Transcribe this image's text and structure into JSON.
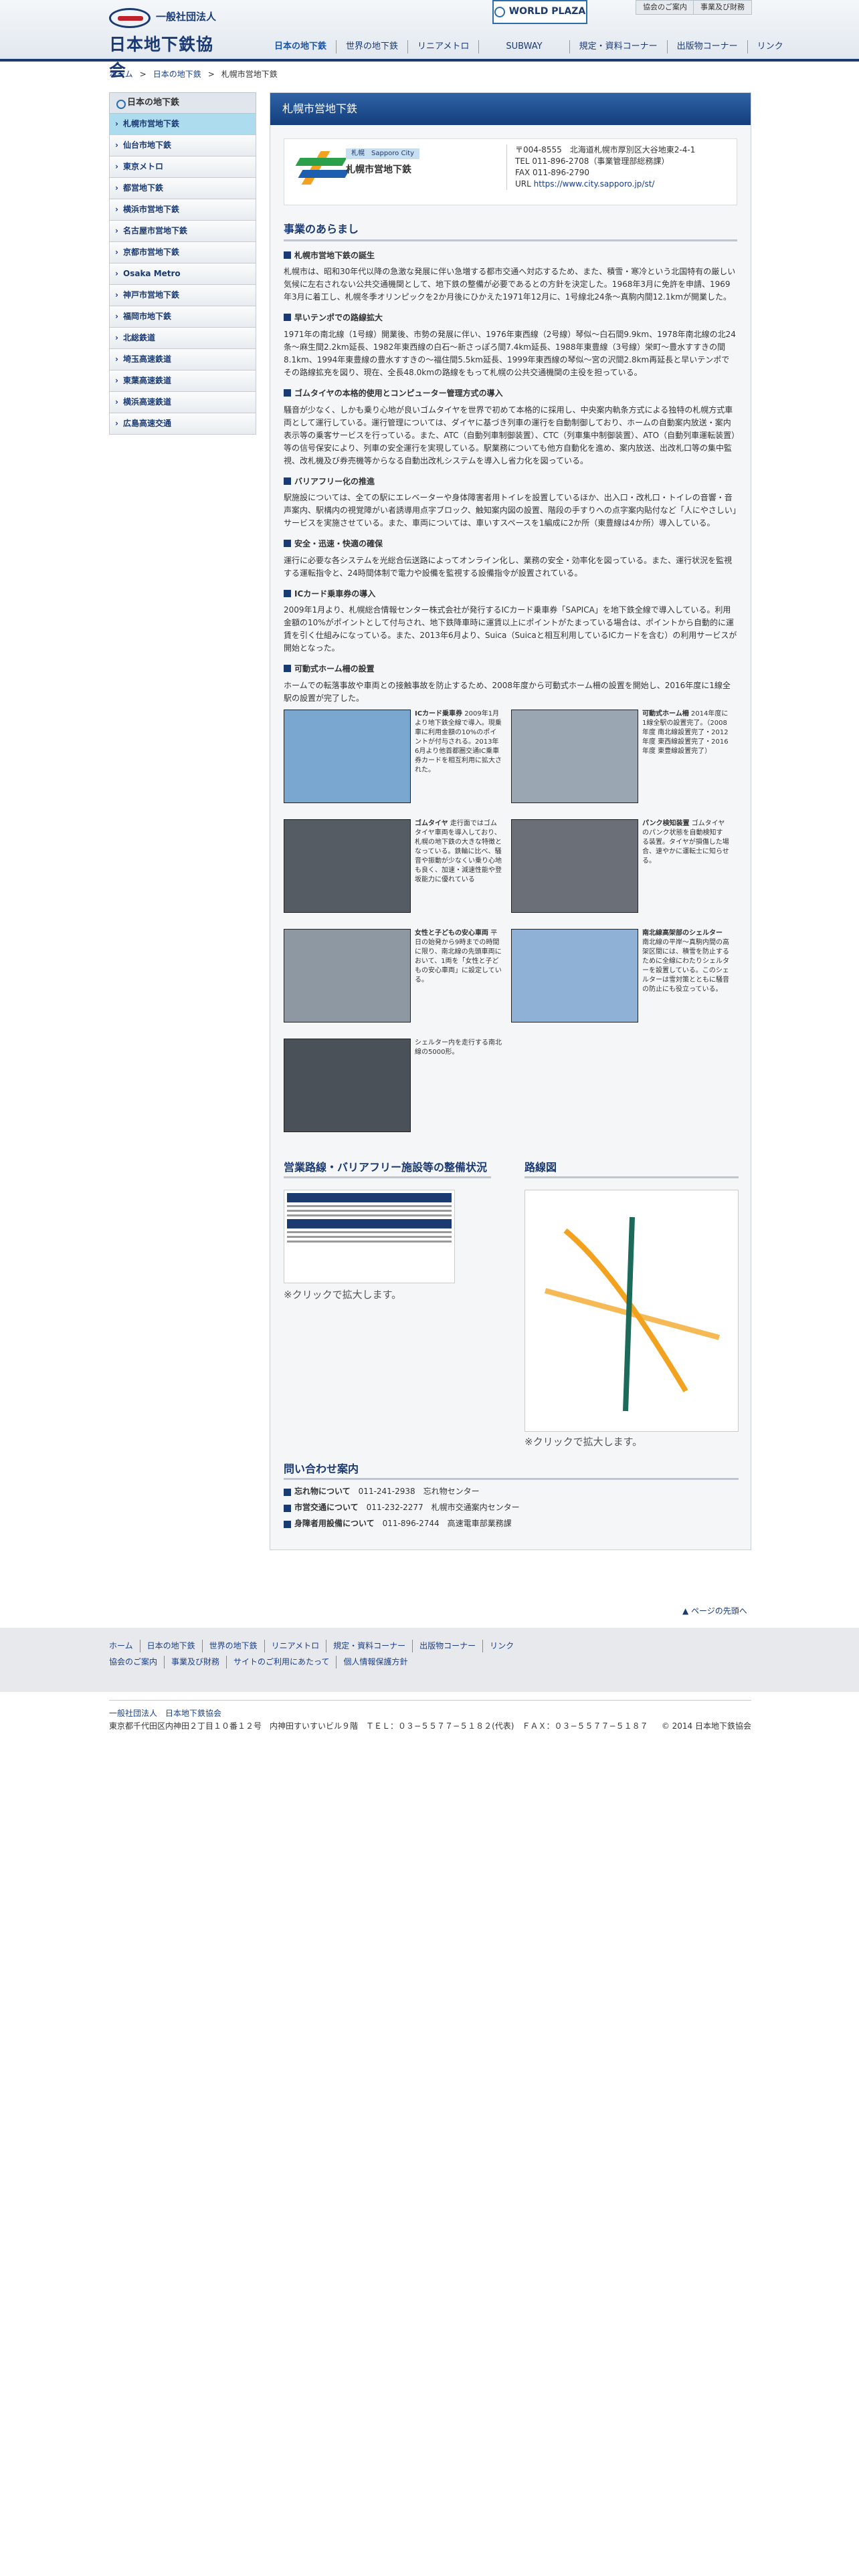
{
  "header": {
    "org_type": "一般社団法人",
    "org_name": "日本地下鉄協会",
    "world_plaza": "WORLD PLAZA",
    "top_links": [
      "協会のご案内",
      "事業及び財務"
    ],
    "nav": [
      "日本の地下鉄",
      "世界の地下鉄",
      "リニアメトロ",
      "SUBWAY",
      "規定・資料コーナー",
      "出版物コーナー",
      "リンク"
    ]
  },
  "breadcrumb": [
    "ホーム",
    "日本の地下鉄",
    "札幌市営地下鉄"
  ],
  "sidebar": {
    "title": "日本の地下鉄",
    "items": [
      "札幌市営地下鉄",
      "仙台市地下鉄",
      "東京メトロ",
      "都営地下鉄",
      "横浜市営地下鉄",
      "名古屋市営地下鉄",
      "京都市営地下鉄",
      "Osaka Metro",
      "神戸市営地下鉄",
      "福岡市地下鉄",
      "北総鉄道",
      "埼玉高速鉄道",
      "東葉高速鉄道",
      "横浜高速鉄道",
      "広島高速交通"
    ]
  },
  "page": {
    "title": "札幌市営地下鉄",
    "tag": "札幌　Sapporo City",
    "name": "札幌市営地下鉄",
    "address": [
      "〒004-8555　北海道札幌市厚別区大谷地東2-4-1",
      "TEL 011-896-2708（事業管理部総務課）",
      "FAX 011-896-2790",
      "URL"
    ],
    "url": "https://www.city.sapporo.jp/st/",
    "section1": "事業のあらまし",
    "items": [
      {
        "h": "札幌市営地下鉄の誕生",
        "t": "札幌市は、昭和30年代以降の急激な発展に伴い急増する都市交通へ対応するため、また、積雪・寒冷という北国特有の厳しい気候に左右されない公共交通機関として、地下鉄の整備が必要であるとの方針を決定した。1968年3月に免許を申請、1969年3月に着工し、札幌冬季オリンピックを2か月後にひかえた1971年12月に、1号線北24条〜真駒内間12.1kmが開業した。"
      },
      {
        "h": "早いテンポでの路線拡大",
        "t": "1971年の南北線（1号線）開業後、市勢の発展に伴い、1976年東西線（2号線）琴似〜白石間9.9km、1978年南北線の北24条〜麻生間2.2km延長、1982年東西線の白石〜新さっぽろ間7.4km延長、1988年東豊線（3号線）栄町〜豊水すすきの間8.1km、1994年東豊線の豊水すすきの〜福住間5.5km延長、1999年東西線の琴似〜宮の沢間2.8km再延長と早いテンポでその路線拡充を図り、現在、全長48.0kmの路線をもって札幌の公共交通機関の主役を担っている。"
      },
      {
        "h": "ゴムタイヤの本格的使用とコンピューター管理方式の導入",
        "t": "騒音が少なく、しかも乗り心地が良いゴムタイヤを世界で初めて本格的に採用し、中央案内軌条方式による独特の札幌方式車両として運行している。運行管理については、ダイヤに基づき列車の運行を自動制御しており、ホームの自動案内放送・案内表示等の乗客サービスを行っている。また、ATC（自動列車制御装置）、CTC（列車集中制御装置）、ATO（自動列車運転装置）等の信号保安により、列車の安全運行を実現している。駅業務についても他方自動化を進め、案内放送、出改札口等の集中監視、改札機及び券売機等からなる自動出改札システムを導入し省力化を図っている。"
      },
      {
        "h": "バリアフリー化の推進",
        "t": "駅施設については、全ての駅にエレベーターや身体障害者用トイレを設置しているほか、出入口・改札口・トイレの音響・音声案内、駅構内の視覚障がい者誘導用点字ブロック、触知案内図の設置、階段の手すりへの点字案内貼付など「人にやさしい」サービスを実施させている。また、車両については、車いすスペースを1編成に2か所（東豊線は4か所）導入している。"
      },
      {
        "h": "安全・迅速・快適の確保",
        "t": "運行に必要な各システムを光総合伝送路によってオンライン化し、業務の安全・効率化を図っている。また、運行状況を監視する運転指令と、24時間体制で電力や設備を監視する設備指令が設置されている。"
      },
      {
        "h": "ICカード乗車券の導入",
        "t": "2009年1月より、札幌総合情報センター株式会社が発行するICカード乗車券「SAPICA」を地下鉄全線で導入している。利用金額の10%がポイントとして付与され、地下鉄降車時に運賃以上にポイントがたまっている場合は、ポイントから自動的に運賃を引く仕組みになっている。また、2013年6月より、Suica（Suicaと相互利用しているICカードを含む）の利用サービスが開始となった。"
      },
      {
        "h": "可動式ホーム柵の設置",
        "t": "ホームでの転落事故や車両との接触事故を防止するため、2008年度から可動式ホーム柵の設置を開始し、2016年度に1線全駅の設置が完了した。"
      }
    ],
    "photos": [
      {
        "b": "ICカード乗車券",
        "t": "2009年1月より地下鉄全線で導入。現乗車に利用金額の10%のポイントが付与される。2013年6月より他首都圏交通IC乗車券カードを相互利用に拡大された。"
      },
      {
        "b": "可動式ホーム柵",
        "t": "2014年度に1線全駅の設置完了。（2008年度 南北線設置完了・2012年度 東西線設置完了・2016年度 東豊線設置完了）"
      },
      {
        "b": "ゴムタイヤ",
        "t": "走行面ではゴムタイヤ車両を導入しており、札幌の地下鉄の大きな特徴となっている。鉄輪に比べ、騒音や振動が少なくい乗り心地も良く、加速・減速性能や登坂能力に優れている"
      },
      {
        "b": "パンク検知装置",
        "t": "ゴムタイヤのパンク状態を自動検知する装置。タイヤが損傷した場合、速やかに運転士に知らせる。"
      },
      {
        "b": "女性と子どもの安心車両",
        "t": "平日の始発から9時までの時間に限り、南北線の先頭車両において、1両を「女性と子どもの安心車両」に設定している。"
      },
      {
        "b": "南北線高架部のシェルター",
        "t": "南北線の平岸〜真駒内間の高架区間には、積雪を防止するために全線にわたりシェルターを設置している。このシェルターは雪対策とともに騒音の防止にも役立っている。"
      },
      {
        "b": "",
        "t": "シェルター内を走行する南北線の5000形。"
      }
    ],
    "barrierfree_title": "営業路線・バリアフリー施設等の整備状況",
    "map_title": "路線図",
    "zoom_note": "※クリックで拡大します。",
    "contact_title": "問い合わせ案内",
    "contacts": [
      [
        "忘れ物について",
        "011-241-2938　忘れ物センター"
      ],
      [
        "市営交通について",
        "011-232-2277　札幌市交通案内センター"
      ],
      [
        "身障者用設備について",
        "011-896-2744　高速電車部業務課"
      ]
    ]
  },
  "footer": {
    "page_top": "ページの先頭へ",
    "links1": [
      "ホーム",
      "日本の地下鉄",
      "世界の地下鉄",
      "リニアメトロ",
      "規定・資料コーナー",
      "出版物コーナー",
      "リンク"
    ],
    "links2": [
      "協会のご案内",
      "事業及び財務",
      "サイトのご利用にあたって",
      "個人情報保護方針"
    ],
    "org": "一般社団法人　日本地下鉄協会",
    "address": "東京都千代田区内神田２丁目１０番１２号　内神田すいすいビル９階　ＴＥＬ：０３−５５７７−５１８２(代表)　ＦＡＸ：０３−５５７７−５１８７",
    "copy": "© 2014 日本地下鉄協会"
  }
}
